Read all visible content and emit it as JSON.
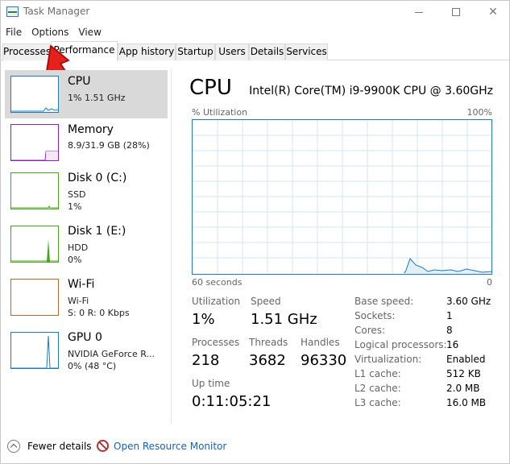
{
  "window": {
    "title": "Task Manager"
  },
  "menu": [
    "File",
    "Options",
    "View"
  ],
  "tabs": [
    "Processes",
    "Performance",
    "App history",
    "Startup",
    "Users",
    "Details",
    "Services"
  ],
  "resources": [
    {
      "name": "CPU",
      "line1": "1% 1.51 GHz",
      "line2": "",
      "color": "#1e7bbf"
    },
    {
      "name": "Memory",
      "line1": "8.9/31.9 GB (28%)",
      "line2": "",
      "color": "#8b23b8"
    },
    {
      "name": "Disk 0 (C:)",
      "line1": "SSD",
      "line2": "1%",
      "color": "#4aa31c"
    },
    {
      "name": "Disk 1 (E:)",
      "line1": "HDD",
      "line2": "0%",
      "color": "#4aa31c"
    },
    {
      "name": "Wi-Fi",
      "line1": "Wi-Fi",
      "line2": "S: 0 R: 0 Kbps",
      "color": "#b86b2a"
    },
    {
      "name": "GPU 0",
      "line1": "NVIDIA GeForce R...",
      "line2": "0% (48 °C)",
      "color": "#1e7bbf"
    }
  ],
  "main": {
    "title": "CPU",
    "model": "Intel(R) Core(TM) i9-9900K CPU @ 3.60GHz",
    "graph": {
      "top_left": "% Utilization",
      "top_right": "100%",
      "bottom_left": "60 seconds",
      "bottom_right": "0"
    },
    "stats": {
      "utilization_label": "Utilization",
      "utilization": "1%",
      "speed_label": "Speed",
      "speed": "1.51 GHz",
      "processes_label": "Processes",
      "processes": "218",
      "threads_label": "Threads",
      "threads": "3682",
      "handles_label": "Handles",
      "handles": "96330",
      "uptime_label": "Up time",
      "uptime": "0:11:05:21"
    },
    "specs": [
      {
        "label": "Base speed:",
        "value": "3.60 GHz"
      },
      {
        "label": "Sockets:",
        "value": "1"
      },
      {
        "label": "Cores:",
        "value": "8"
      },
      {
        "label": "Logical processors:",
        "value": "16"
      },
      {
        "label": "Virtualization:",
        "value": "Enabled"
      },
      {
        "label": "L1 cache:",
        "value": "512 KB"
      },
      {
        "label": "L2 cache:",
        "value": "2.0 MB"
      },
      {
        "label": "L3 cache:",
        "value": "16.0 MB"
      }
    ]
  },
  "footer": {
    "fewer_details": "Fewer details",
    "open_monitor": "Open Resource Monitor"
  },
  "colors": {
    "cpu_line": "#1e7bbf",
    "grid": "#d4e6f3",
    "arrow": "#e8201c"
  }
}
